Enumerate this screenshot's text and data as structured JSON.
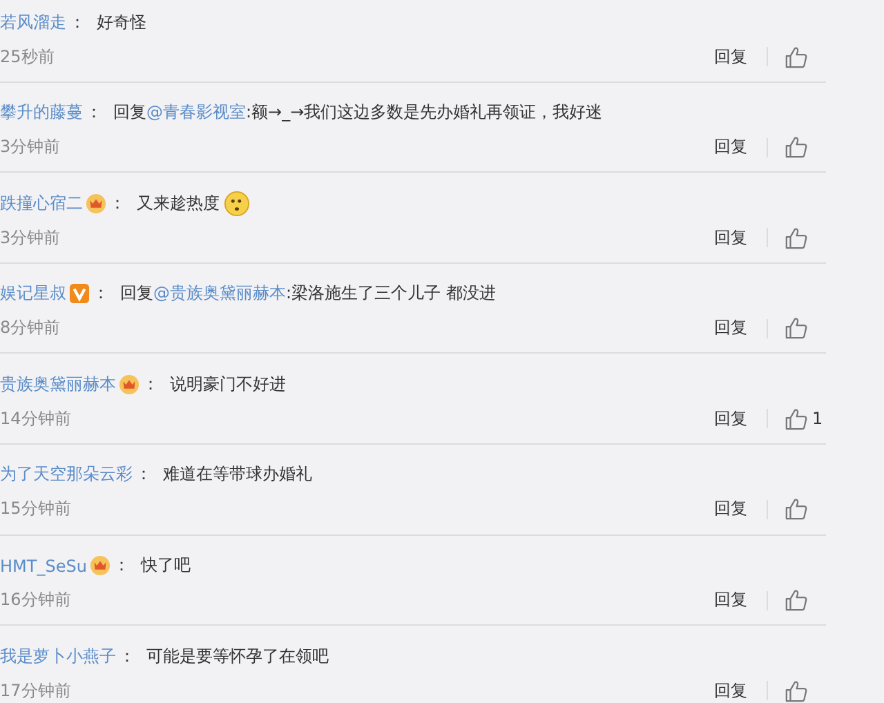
{
  "comments": [
    {
      "user": "若风溜走",
      "colon": "：",
      "text": "好奇怪",
      "emoji": false,
      "time": "25秒前",
      "reply": "回复"
    },
    {
      "user": "攀升的藤蔓",
      "colon": "：",
      "reply_label": "回复",
      "mention": "@青春影视室",
      "text": ":额→_→我们这边多数是先办婚礼再领证，我好迷",
      "emoji": false,
      "time": "3分钟前",
      "reply": "回复"
    },
    {
      "user": "跌撞心宿二",
      "badge": {
        "kind": "crown"
      },
      "colon": "：",
      "text": "又来趁热度",
      "emoji": true,
      "time": "3分钟前",
      "reply": "回复"
    },
    {
      "user": "娱记星叔",
      "badge": {
        "kind": "vip"
      },
      "colon": "：",
      "reply_label": "回复",
      "mention": "@贵族奥黛丽赫本",
      "text": ":梁洛施生了三个儿子 都没进",
      "emoji": false,
      "time": "8分钟前",
      "reply": "回复"
    },
    {
      "user": "贵族奥黛丽赫本",
      "badge": {
        "kind": "crown"
      },
      "colon": "：",
      "text": "说明豪门不好进",
      "emoji": false,
      "time": "14分钟前",
      "reply": "回复",
      "likes": "1"
    },
    {
      "user": "为了天空那朵云彩",
      "colon": "：",
      "text": "难道在等带球办婚礼",
      "emoji": false,
      "time": "15分钟前",
      "reply": "回复"
    },
    {
      "user": "HMT_SeSu",
      "badge": {
        "kind": "crown"
      },
      "colon": "：",
      "text": "快了吧",
      "emoji": false,
      "time": "16分钟前",
      "reply": "回复"
    },
    {
      "user": "我是萝卜小燕子",
      "colon": "：",
      "text": "可能是要等怀孕了在领吧",
      "emoji": false,
      "time": "17分钟前",
      "reply": "回复"
    }
  ]
}
